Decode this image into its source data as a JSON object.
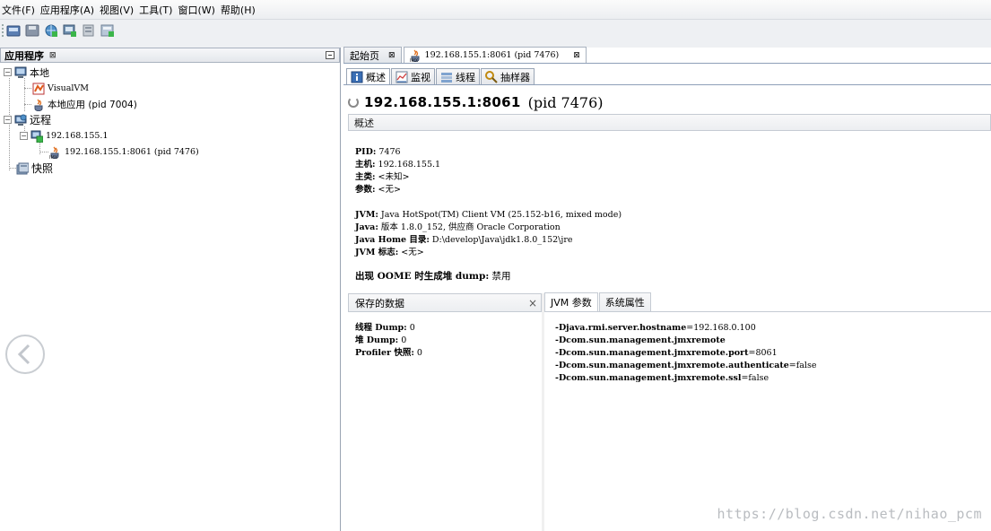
{
  "menubar": [
    "文件(F)",
    "应用程序(A)",
    "视图(V)",
    "工具(T)",
    "窗口(W)",
    "帮助(H)"
  ],
  "toolbar": {
    "icons": [
      "load-application-icon",
      "save-icon",
      "add-remote-host-icon",
      "add-jmx-connection-icon",
      "add-snapshot-icon",
      "add-coredump-icon"
    ]
  },
  "left_panel": {
    "tab_label": "应用程序",
    "tab_close": "⊠",
    "tree": {
      "local": "本地",
      "visualvm": "VisualVM",
      "local_app": "本地应用 (pid 7004)",
      "remote": "远程",
      "remote_host": "192.168.155.1",
      "remote_app": "192.168.155.1:8061 (pid 7476)",
      "snapshots": "快照"
    }
  },
  "right_panel": {
    "doc_tabs": [
      {
        "label": "起始页",
        "close": "⊠"
      },
      {
        "label": "192.168.155.1:8061 (pid 7476)",
        "close": "⊠"
      }
    ],
    "sub_tabs": [
      "概述",
      "监视",
      "线程",
      "抽样器"
    ],
    "heading_host": "192.168.155.1:8061",
    "heading_pid": "(pid 7476)",
    "overview_section": "概述",
    "info": {
      "pid_label": "PID:",
      "pid_value": "7476",
      "host_label": "主机:",
      "host_value": "192.168.155.1",
      "main_class_label": "主类:",
      "main_class_value": "<未知>",
      "args_label": "参数:",
      "args_value": "<无>",
      "jvm_label": "JVM:",
      "jvm_value": "Java HotSpot(TM) Client VM (25.152-b16, mixed mode)",
      "java_label": "Java:",
      "java_value": "版本 1.8.0_152, 供应商 Oracle Corporation",
      "java_home_label": "Java Home 目录:",
      "java_home_value": "D:\\develop\\Java\\jdk1.8.0_152\\jre",
      "jvm_flags_label": "JVM 标志:",
      "jvm_flags_value": "<无>",
      "oome_label": "出现 OOME 时生成堆 dump:",
      "oome_value": "禁用"
    },
    "saved_data": {
      "title": "保存的数据",
      "close": "×",
      "thread_dump_label": "线程 Dump:",
      "thread_dump_value": "0",
      "heap_dump_label": "堆 Dump:",
      "heap_dump_value": "0",
      "profiler_label": "Profiler 快照:",
      "profiler_value": "0"
    },
    "bottom_tabs": [
      "JVM 参数",
      "系统属性"
    ],
    "jvm_args": [
      {
        "key": "-Djava.rmi.server.hostname",
        "value": "=192.168.0.100"
      },
      {
        "key": "-Dcom.sun.management.jmxremote",
        "value": ""
      },
      {
        "key": "-Dcom.sun.management.jmxremote.port",
        "value": "=8061"
      },
      {
        "key": "-Dcom.sun.management.jmxremote.authenticate",
        "value": "=false"
      },
      {
        "key": "-Dcom.sun.management.jmxremote.ssl",
        "value": "=false"
      }
    ]
  },
  "watermark": "https://blog.csdn.net/nihao_pcm"
}
